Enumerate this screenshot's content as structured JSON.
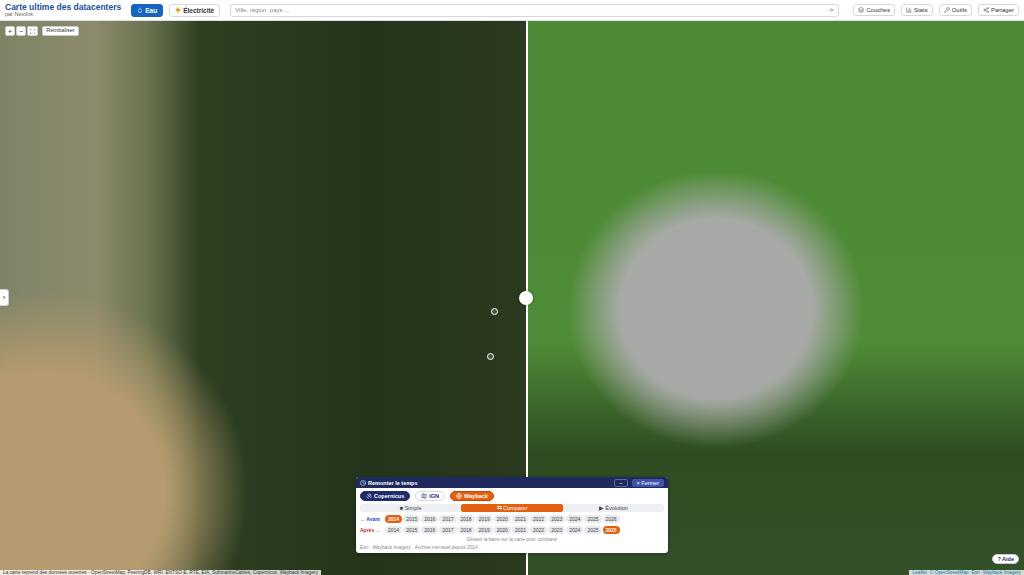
{
  "app": {
    "title": "Carte ultime des datacenters",
    "subtitle": "par NextInk"
  },
  "layers": [
    {
      "label": "Eau",
      "selected": true
    },
    {
      "label": "Électricité",
      "selected": false
    }
  ],
  "search": {
    "placeholder": "Ville, région, pays ..."
  },
  "toolbar": [
    "Couches",
    "Stats",
    "Outils",
    "Partager"
  ],
  "zoom": {
    "buttons": [
      "+",
      "−",
      "⛶"
    ],
    "reset": "Réinitialiser"
  },
  "side_toggle": "›",
  "compare": {
    "level": 0.515
  },
  "time_panel": {
    "title": "Remonter le temps",
    "minimize": "−",
    "close": "× Fermer",
    "sources": [
      {
        "label": "Copernicus",
        "selected": false,
        "highlighted": true,
        "color": "#1f2d6b"
      },
      {
        "label": "IGN",
        "selected": false,
        "highlighted": false,
        "color": "#ffffff"
      },
      {
        "label": "Wayback",
        "selected": true,
        "highlighted": true,
        "color": "#e2600f"
      }
    ],
    "modes": [
      {
        "label": "■ Simple",
        "selected": false
      },
      {
        "label": "⇆ Comparer",
        "selected": true
      },
      {
        "label": "▶ Évolution",
        "selected": false
      }
    ],
    "rows": [
      {
        "label": "← Avant",
        "color": "#1f4fb5",
        "years": [
          {
            "label": "2014",
            "selected": true
          },
          {
            "label": "2015",
            "selected": false
          },
          {
            "label": "2016",
            "selected": false
          },
          {
            "label": "2017",
            "selected": false
          },
          {
            "label": "2018",
            "selected": false
          },
          {
            "label": "2019",
            "selected": false
          },
          {
            "label": "2020",
            "selected": false
          },
          {
            "label": "2021",
            "selected": false
          },
          {
            "label": "2022",
            "selected": false
          },
          {
            "label": "2023",
            "selected": false
          },
          {
            "label": "2024",
            "selected": false
          },
          {
            "label": "2025",
            "selected": false
          },
          {
            "label": "2026",
            "selected": false
          }
        ]
      },
      {
        "label": "Après →",
        "color": "#c62828",
        "years": [
          {
            "label": "2014",
            "selected": false
          },
          {
            "label": "2015",
            "selected": false
          },
          {
            "label": "2016",
            "selected": false
          },
          {
            "label": "2017",
            "selected": false
          },
          {
            "label": "2018",
            "selected": false
          },
          {
            "label": "2019",
            "selected": false
          },
          {
            "label": "2020",
            "selected": false
          },
          {
            "label": "2021",
            "selected": false
          },
          {
            "label": "2022",
            "selected": false
          },
          {
            "label": "2023",
            "selected": false
          },
          {
            "label": "2024",
            "selected": false
          },
          {
            "label": "2025",
            "selected": false
          },
          {
            "label": "2025",
            "selected": true
          }
        ]
      }
    ],
    "hint": "Glissez la barre sur la carte pour comparer",
    "source_note": "Esri · Wayback Imagery · Archive mensuel depuis 2014"
  },
  "attribution": {
    "left": "La carte reprend des données ouvertes · OpenStreetMap, PeeringDB, WRI, ENTSO-E, RTE, EIA, SubmarineCables, Copernicus, Wayback Imagery",
    "right": [
      "Leaflet",
      "© OpenStreetMap",
      "Esri",
      "Wayback Imagery"
    ]
  },
  "help": "? Aide"
}
